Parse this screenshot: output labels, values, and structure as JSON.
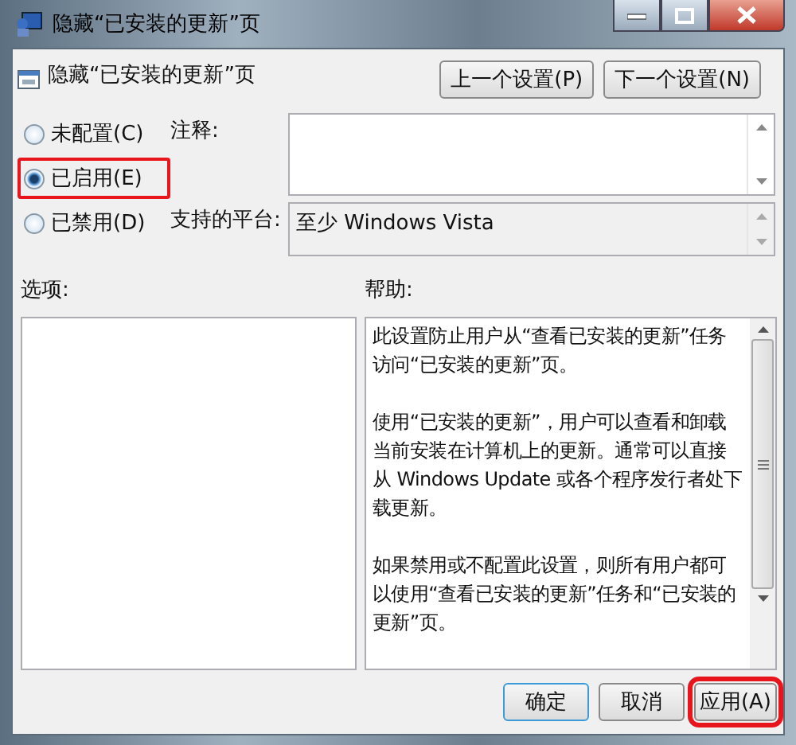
{
  "window": {
    "title": "隐藏“已安装的更新”页"
  },
  "setting_title": "隐藏“已安装的更新”页",
  "nav_buttons": [
    "上一个设置(P)",
    "下一个设置(N)"
  ],
  "states": [
    {
      "label": "未配置(C)",
      "selected": false,
      "highlighted": false
    },
    {
      "label": "已启用(E)",
      "selected": true,
      "highlighted": true
    },
    {
      "label": "已禁用(D)",
      "selected": false,
      "highlighted": false
    }
  ],
  "comment": {
    "label": "注释:"
  },
  "platform": {
    "label": "支持的平台:",
    "value": "至少 Windows Vista"
  },
  "options": {
    "label": "选项:"
  },
  "help": {
    "label": "帮助:",
    "paragraphs": [
      "此设置防止用户从“查看已安装的更新”任务访问“已安装的更新”页。",
      "使用“已安装的更新”，用户可以查看和卸载当前安装在计算机上的更新。通常可以直接从 Windows Update 或各个程序发行者处下载更新。",
      "如果禁用或不配置此设置，则所有用户都可以使用“查看已安装的更新”任务和“已安装的更新”页。"
    ]
  },
  "buttons": [
    {
      "label": "确定",
      "kind": "default",
      "highlighted": false
    },
    {
      "label": "取消",
      "kind": "normal",
      "highlighted": false
    },
    {
      "label": "应用(A)",
      "kind": "normal",
      "highlighted": true
    }
  ]
}
